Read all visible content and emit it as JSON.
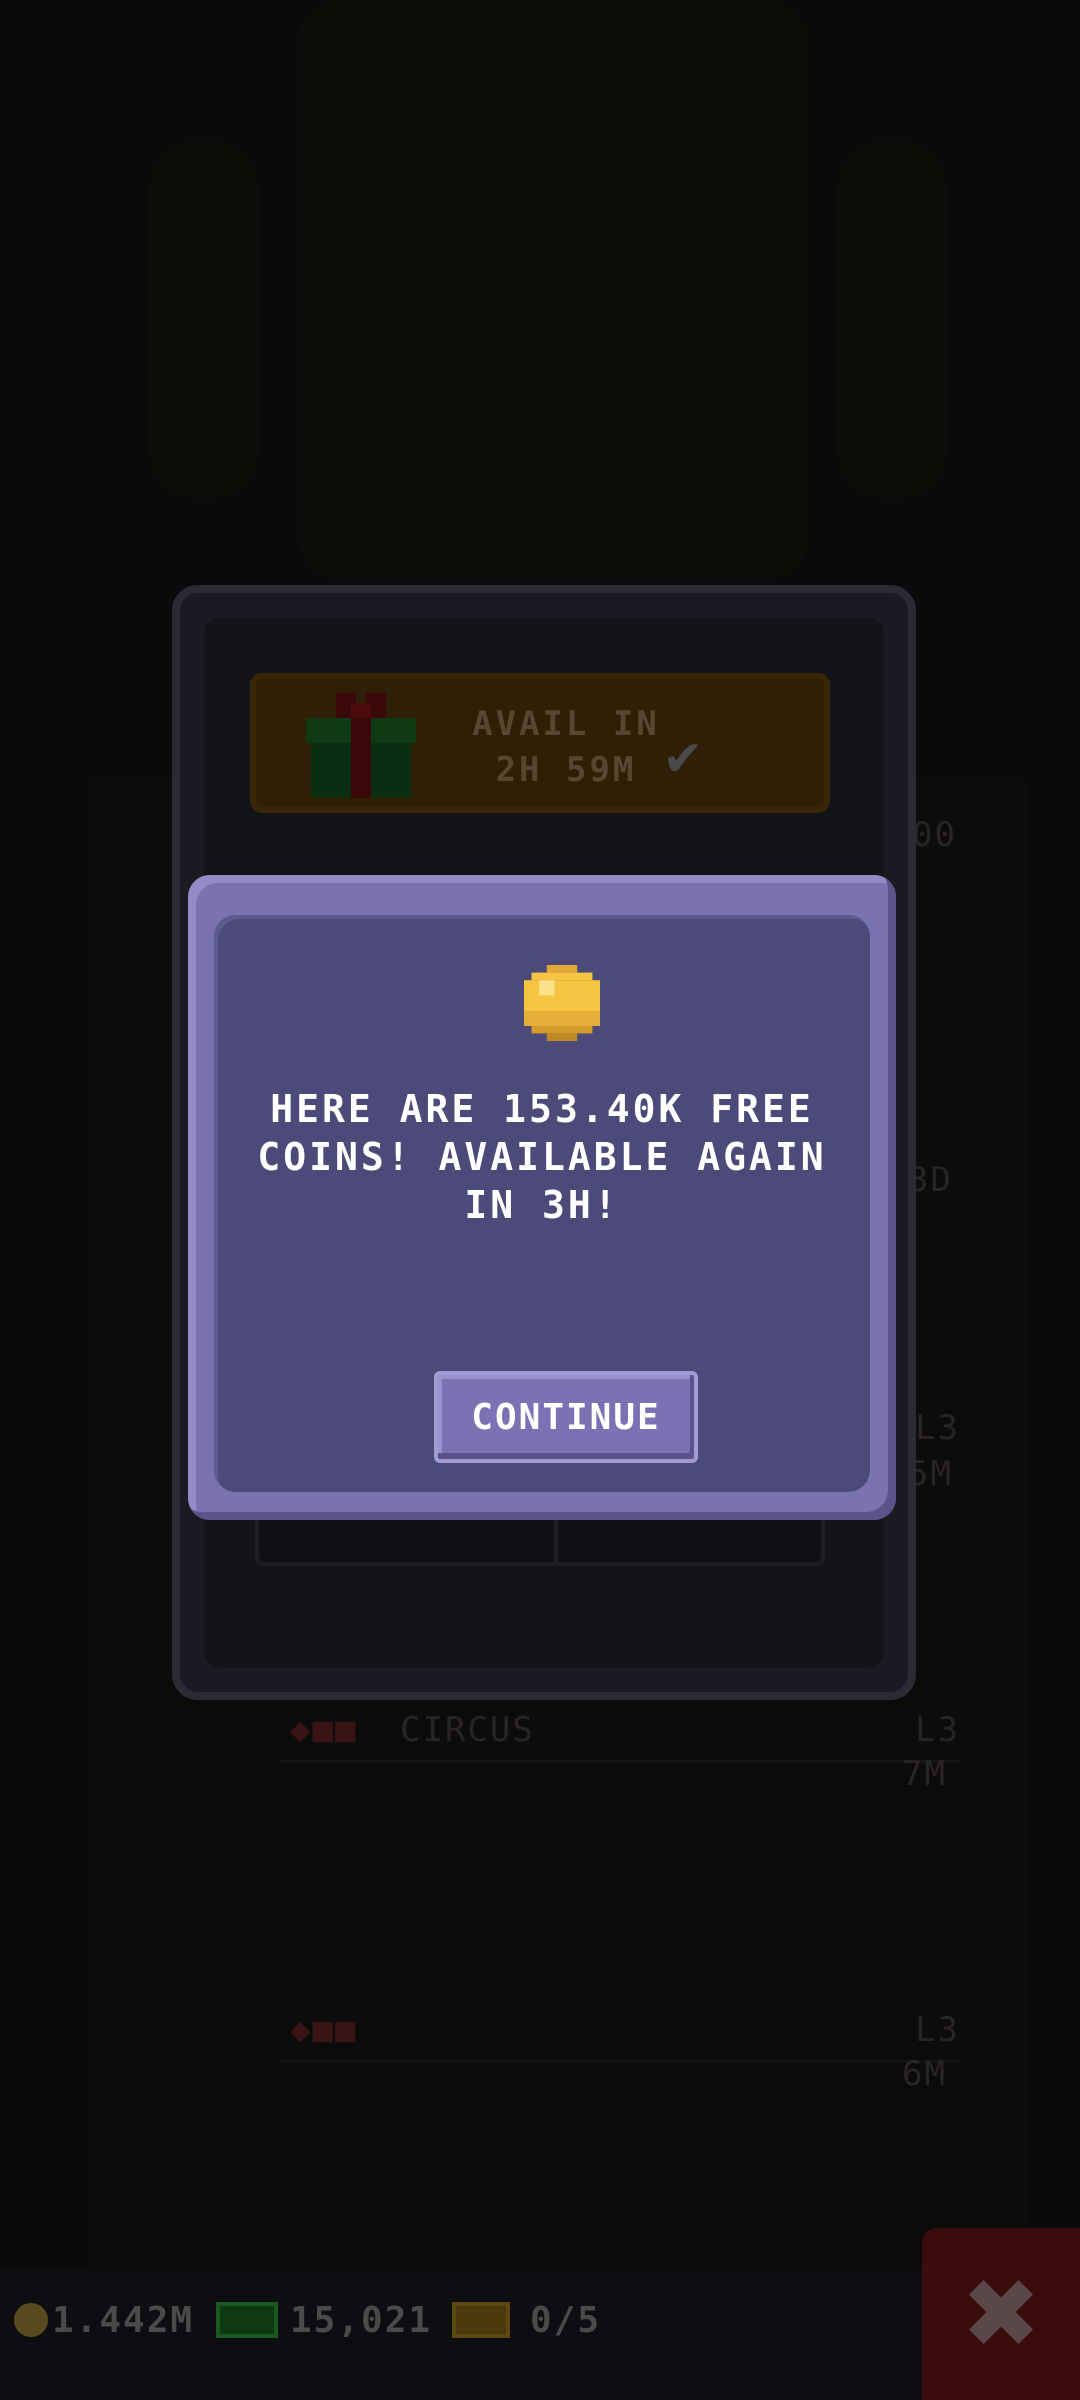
{
  "background": {
    "circus_label": "CIRCUS",
    "circus_level": "L3",
    "circus_time": "7M",
    "floor2_level": "L3",
    "floor2_time": "6M",
    "side_label_1": "L3",
    "side_label_2": "5M",
    "side_label_3": "3D",
    "side_label_4": "00"
  },
  "gift_banner": {
    "line1": "AVAIL IN",
    "line2": "2H 59M"
  },
  "dialog": {
    "message": "HERE ARE 153.40K FREE COINS! AVAILABLE AGAIN IN 3H!",
    "continue_label": "CONTINUE"
  },
  "status_bar": {
    "coins": "1.442M",
    "bux": "15,021",
    "vip": "0/5"
  },
  "colors": {
    "dialog_frame": "#7b72b0",
    "dialog_body": "#4c4a78",
    "coin_gold": "#f5c542",
    "close_red": "#3a0c0c"
  },
  "icons": [
    "gift-icon",
    "check-icon",
    "coin-icon",
    "bux-icon",
    "vip-icon",
    "close-icon"
  ]
}
